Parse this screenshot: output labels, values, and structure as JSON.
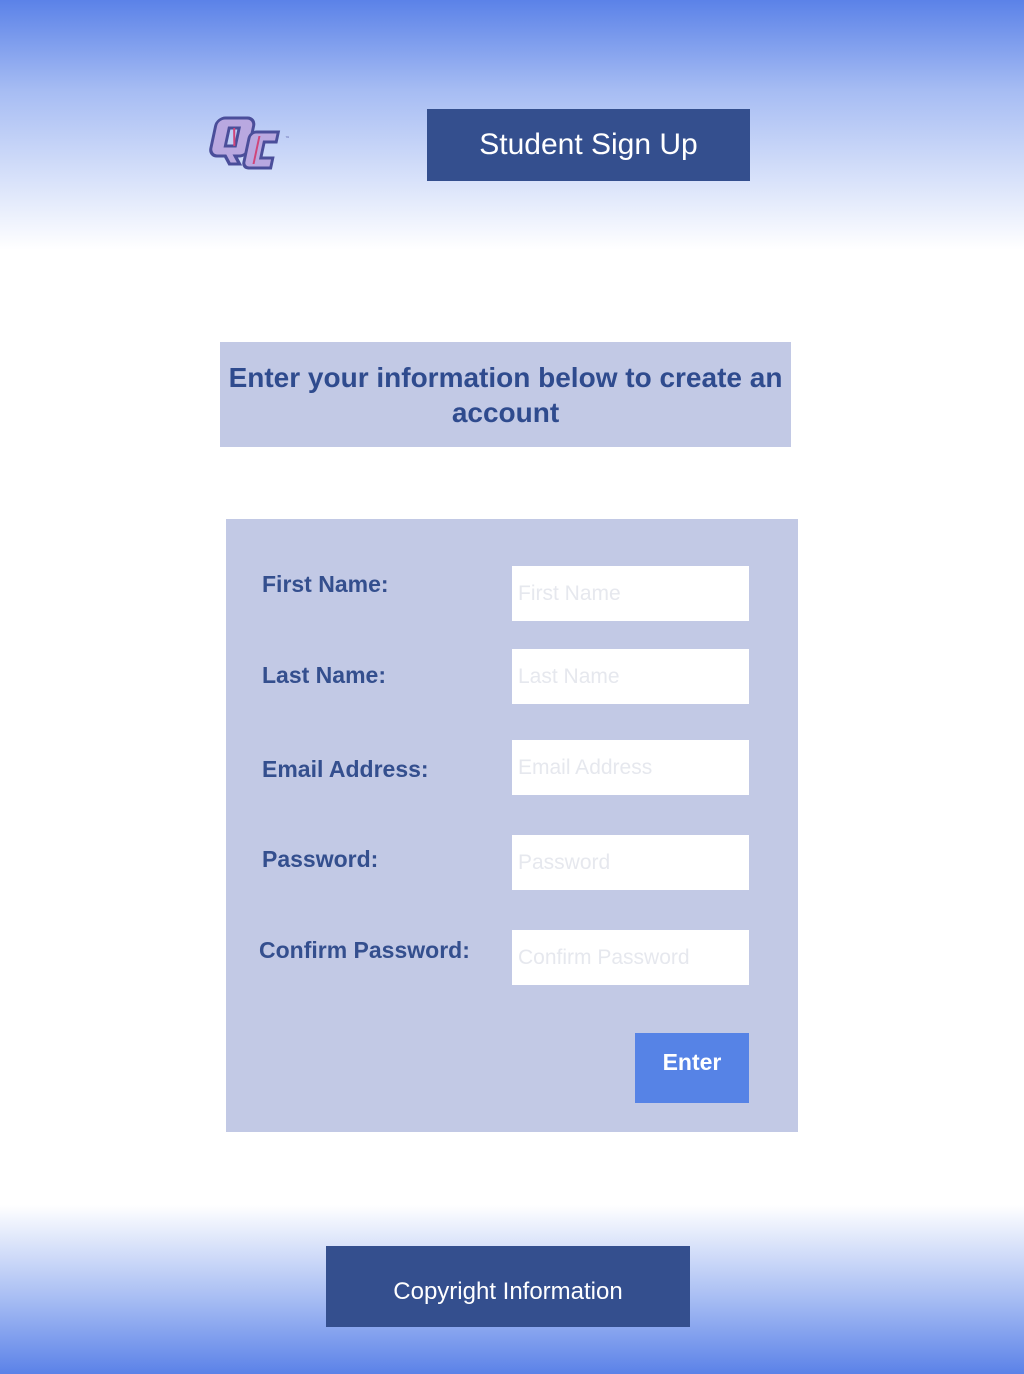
{
  "header": {
    "title": "Student Sign Up"
  },
  "logo": {
    "icon": "qc-monogram-logo",
    "text": "QC",
    "colors": {
      "fill": "#b9a8e0",
      "stroke": "#4a4e9a",
      "accent": "#d0457a"
    }
  },
  "intro": {
    "text": "Enter your information below to create an account"
  },
  "form": {
    "fields": [
      {
        "label": "First Name:",
        "placeholder": "First Name",
        "value": ""
      },
      {
        "label": "Last Name:",
        "placeholder": "Last Name",
        "value": ""
      },
      {
        "label": "Email Address:",
        "placeholder": "Email Address",
        "value": ""
      },
      {
        "label": "Password:",
        "placeholder": "Password",
        "value": ""
      },
      {
        "label": "Confirm Password:",
        "placeholder": "Confirm Password",
        "value": ""
      }
    ],
    "submit_label": "Enter"
  },
  "footer": {
    "text": "Copyright Information"
  },
  "colors": {
    "brand_dark": "#344f8e",
    "panel": "#c2c9e5",
    "accent_button": "#5683e6",
    "gradient_edge": "#5b82e8"
  }
}
